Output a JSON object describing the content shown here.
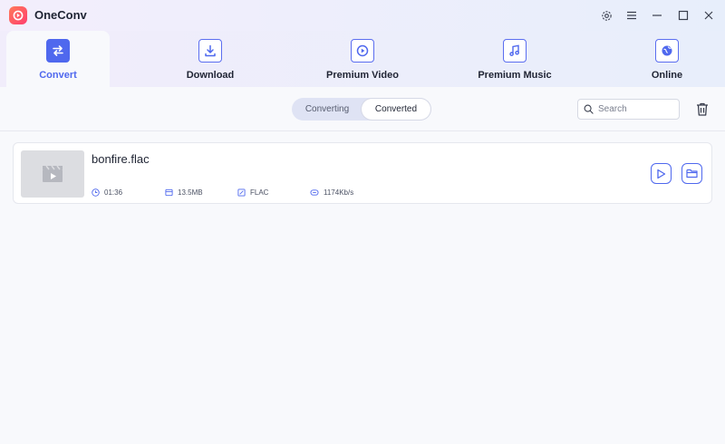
{
  "app": {
    "title": "OneConv"
  },
  "window_controls": [
    "settings-icon",
    "menu-icon",
    "minimize-icon",
    "maximize-icon",
    "close-icon"
  ],
  "nav": {
    "tabs": [
      {
        "label": "Convert",
        "icon": "convert-arrows-icon",
        "active": true
      },
      {
        "label": "Download",
        "icon": "download-icon",
        "active": false
      },
      {
        "label": "Premium Video",
        "icon": "play-circle-icon",
        "active": false
      },
      {
        "label": "Premium Music",
        "icon": "music-note-icon",
        "active": false
      },
      {
        "label": "Online",
        "icon": "globe-icon",
        "active": false
      }
    ]
  },
  "toolbar": {
    "segments": [
      {
        "label": "Converting",
        "active": false
      },
      {
        "label": "Converted",
        "active": true
      }
    ],
    "search_placeholder": "Search"
  },
  "files": [
    {
      "name": "bonfire.flac",
      "duration": "01:36",
      "size": "13.5MB",
      "format": "FLAC",
      "bitrate": "1174Kb/s"
    }
  ],
  "colors": {
    "accent": "#4f68ee",
    "brand_gradient_start": "#ff7a59",
    "brand_gradient_end": "#ff3d6e"
  }
}
